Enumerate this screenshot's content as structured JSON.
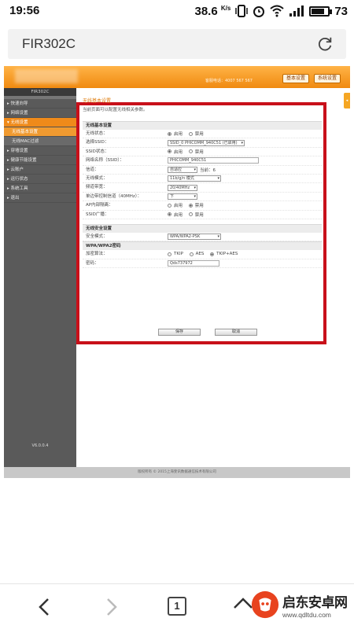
{
  "status_bar": {
    "time": "19:56",
    "speed": "38.6",
    "speed_unit": "K/s",
    "battery": "73"
  },
  "browser": {
    "address": "FIR302C"
  },
  "router_page": {
    "hotline": "客服电话：4007 567 567",
    "header_buttons": [
      "基本设置",
      "系统设置"
    ],
    "brand": "FIR302C",
    "version": "V6.0.0.4",
    "sidebar": [
      {
        "label": "▸ 快速向导",
        "state": "normal"
      },
      {
        "label": "▸ 网络设置",
        "state": "normal"
      },
      {
        "label": "▾ 无线设置",
        "state": "active"
      },
      {
        "label": "无线基本设置",
        "state": "sub-active"
      },
      {
        "label": "无线MAC过滤",
        "state": "sub"
      },
      {
        "label": "▸ 穿墙设置",
        "state": "normal"
      },
      {
        "label": "▸ 健康节能设置",
        "state": "normal"
      },
      {
        "label": "▸ 云账户",
        "state": "normal"
      },
      {
        "label": "▸ 运行状态",
        "state": "normal"
      },
      {
        "label": "▸ 系统工具",
        "state": "normal"
      },
      {
        "label": "▸ 退出",
        "state": "normal"
      }
    ],
    "page_title": "无线基本设置",
    "page_desc": "当前页面可以配置无线相关参数。",
    "basic_section": "无线基本设置",
    "rows": {
      "wireless_state": {
        "label": "无线状态：",
        "opt1": "启用",
        "opt2": "禁用"
      },
      "ssid_select": {
        "label": "选择SSID：",
        "value": "SSID_0 PHICOMM_940C51 (已启用)"
      },
      "ssid_state": {
        "label": "SSID状态：",
        "opt1": "启用",
        "opt2": "禁用"
      },
      "ssid_name": {
        "label": "网络名称（SSID）：",
        "value": "PHICOMM_940C51"
      },
      "channel": {
        "label": "信道：",
        "value": "自适应",
        "current": "当前：6"
      },
      "mode": {
        "label": "无线模式：",
        "value": "11b/g/n 模式"
      },
      "bandwidth": {
        "label": "频道带宽：",
        "value": "20/40MHz"
      },
      "ext_channel": {
        "label": "单边带控制信道（40MHz）：",
        "value": "下"
      },
      "ap_isolation": {
        "label": "AP内部隔离：",
        "opt1": "启用",
        "opt2": "禁用"
      },
      "ssid_broadcast": {
        "label": "SSID广播：",
        "opt1": "启用",
        "opt2": "禁用"
      }
    },
    "security_section": "无线安全设置",
    "security_mode": {
      "label": "安全模式：",
      "value": "WPA/WPA2-PSK"
    },
    "wpa_section": "WPA/WPA2密码",
    "encryption": {
      "label": "加密算法：",
      "opt1": "TKIP",
      "opt2": "AES",
      "opt3": "TKIP+AES"
    },
    "password": {
      "label": "密码：",
      "value": "Qds737972"
    },
    "save": "保存",
    "cancel": "取消",
    "footer": "版权所有 © 2015上海斐讯数据通信技术有限公司"
  },
  "toolbar": {
    "tab_count": "1"
  },
  "watermark": {
    "name": "启东安卓网",
    "url": "www.qdltdu.com"
  },
  "colors": {
    "accent_orange": "#f08a10",
    "highlight_red": "#c8101a",
    "sidebar_gray": "#5a5a5a"
  }
}
